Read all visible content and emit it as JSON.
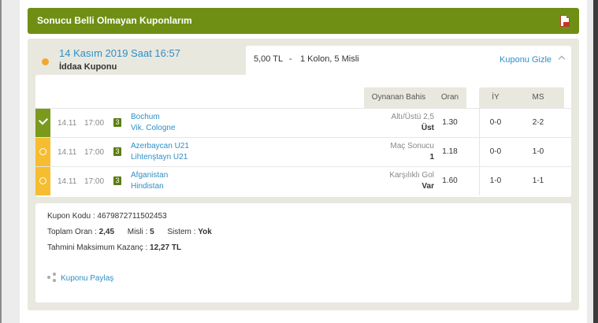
{
  "header": {
    "title": "Sonucu Belli Olmayan Kuponlarım",
    "pdf_icon": "pdf-icon"
  },
  "coupon": {
    "date": "14 Kasım 2019 Saat 16:57",
    "type": "İddaa Kuponu",
    "status_color": "#f0a830",
    "amount": "5,00 TL",
    "separator": "-",
    "columns_info": "1 Kolon, 5 Misli",
    "hide_label": "Kuponu Gizle"
  },
  "table": {
    "headers": {
      "bet": "Oynanan Bahis",
      "odds": "Oran",
      "iy": "İY",
      "ms": "MS"
    },
    "rows": [
      {
        "status": "won",
        "date": "14.11",
        "time": "17:00",
        "badge": "3",
        "home": "Bochum",
        "away": "Vik. Cologne",
        "bet_type": "Altı/Üstü 2,5",
        "pick": "Üst",
        "odds": "1.30",
        "iy": "0-0",
        "ms": "2-2"
      },
      {
        "status": "pending",
        "date": "14.11",
        "time": "17:00",
        "badge": "3",
        "home": "Azerbaycan U21",
        "away": "Lihtenştayn U21",
        "bet_type": "Maç Sonucu",
        "pick": "1",
        "odds": "1.18",
        "iy": "0-0",
        "ms": "1-0"
      },
      {
        "status": "pending",
        "date": "14.11",
        "time": "17:00",
        "badge": "3",
        "home": "Afganistan",
        "away": "Hindistan",
        "bet_type": "Karşılıklı Gol",
        "pick": "Var",
        "odds": "1.60",
        "iy": "1-0",
        "ms": "1-1"
      }
    ]
  },
  "details": {
    "code_label": "Kupon Kodu :",
    "code_value": "4679872711502453",
    "total_odds_label": "Toplam Oran :",
    "total_odds_value": "2,45",
    "multiplier_label": "Misli :",
    "multiplier_value": "5",
    "system_label": "Sistem :",
    "system_value": "Yok",
    "max_win_label": "Tahmini Maksimum Kazanç :",
    "max_win_value": "12,27 TL",
    "share_label": "Kuponu Paylaş",
    "share_icon": "share-icon"
  },
  "colors": {
    "accent": "#6f8f14",
    "link": "#2f8fc7",
    "won": "#7a9a1e",
    "pending": "#f5bd2f"
  }
}
